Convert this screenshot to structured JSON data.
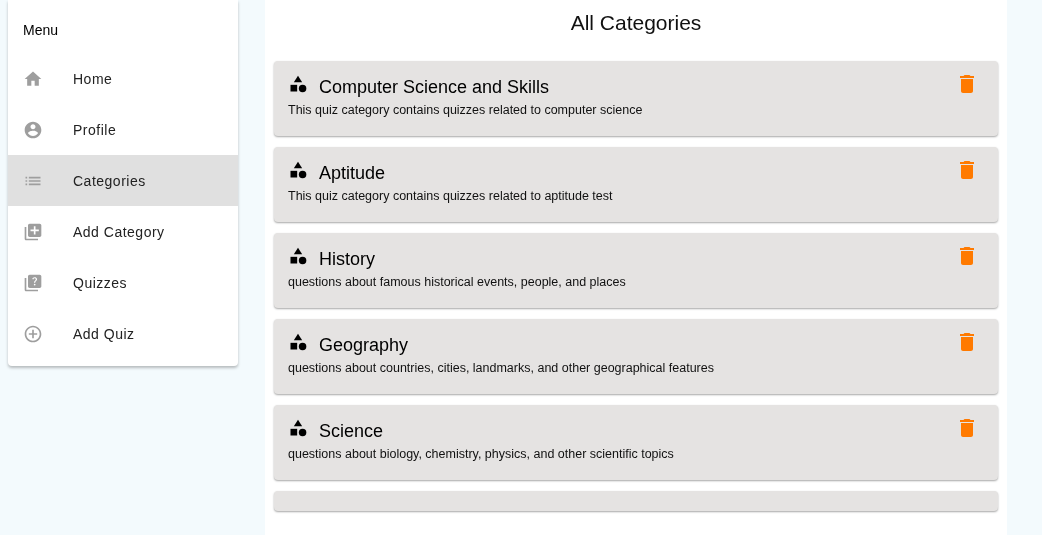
{
  "sidebar": {
    "title": "Menu",
    "items": [
      {
        "label": "Home",
        "kind": "home",
        "selected": false
      },
      {
        "label": "Profile",
        "kind": "profile",
        "selected": false
      },
      {
        "label": "Categories",
        "kind": "list",
        "selected": true
      },
      {
        "label": "Add Category",
        "kind": "add-category",
        "selected": false
      },
      {
        "label": "Quizzes",
        "kind": "quizzes",
        "selected": false
      },
      {
        "label": "Add Quiz",
        "kind": "add-quiz",
        "selected": false
      }
    ]
  },
  "main": {
    "title": "All Categories",
    "categories": [
      {
        "title": "Computer Science and Skills",
        "description": "This quiz category contains quizzes related to computer science"
      },
      {
        "title": "Aptitude",
        "description": "This quiz category contains quizzes related to aptitude test"
      },
      {
        "title": "History",
        "description": "questions about famous historical events, people, and places"
      },
      {
        "title": "Geography",
        "description": "questions about countries, cities, landmarks, and other geographical features"
      },
      {
        "title": "Science",
        "description": "questions about biology, chemistry, physics, and other scientific topics"
      }
    ]
  }
}
